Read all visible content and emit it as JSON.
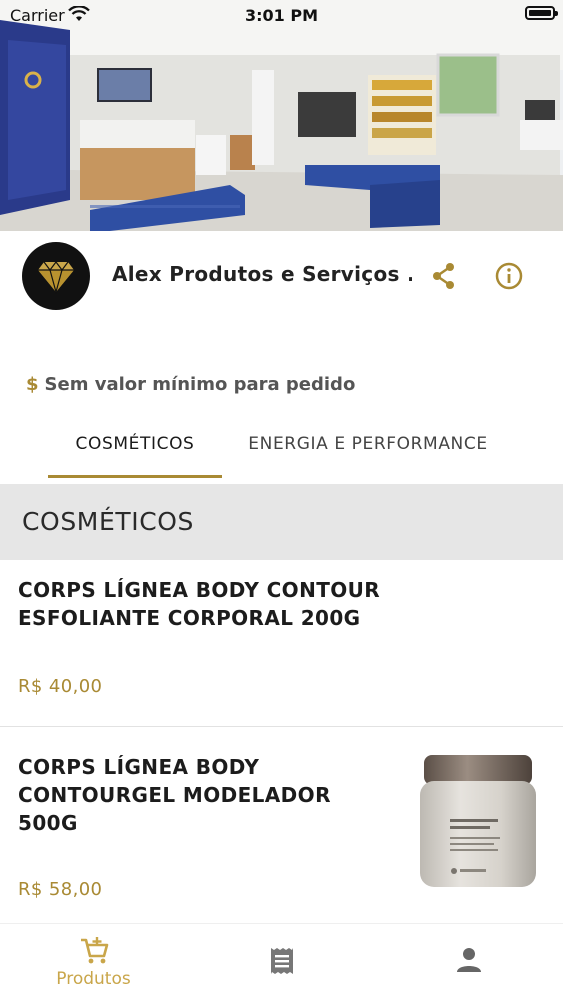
{
  "status_bar": {
    "carrier": "Carrier",
    "time": "3:01 PM"
  },
  "store": {
    "name": "Alex Produtos e Serviços ...",
    "share_icon": "share-icon",
    "info_icon": "info-icon"
  },
  "minimum_order": {
    "icon": "$",
    "text": "Sem valor mínimo para pedido"
  },
  "tabs": [
    {
      "label": "COSMÉTICOS",
      "selected": true
    },
    {
      "label": "ENERGIA E PERFORMANCE",
      "selected": false
    }
  ],
  "section": {
    "title": "COSMÉTICOS"
  },
  "products": [
    {
      "name": "CORPS LÍGNEA BODY CONTOUR ESFOLIANTE CORPORAL 200G",
      "price": "R$ 40,00"
    },
    {
      "name": "CORPS LÍGNEA BODY CONTOURGEL MODELADOR 500G",
      "price": "R$ 58,00"
    }
  ],
  "bottom_nav": [
    {
      "label": "Produtos",
      "icon": "cart-icon",
      "active": true
    },
    {
      "label": "",
      "icon": "receipt-icon",
      "active": false
    },
    {
      "label": "",
      "icon": "person-icon",
      "active": false
    }
  ],
  "colors": {
    "accent": "#a98a34",
    "nav_active": "#c9a64a",
    "section_bg": "#e6e6e6"
  }
}
